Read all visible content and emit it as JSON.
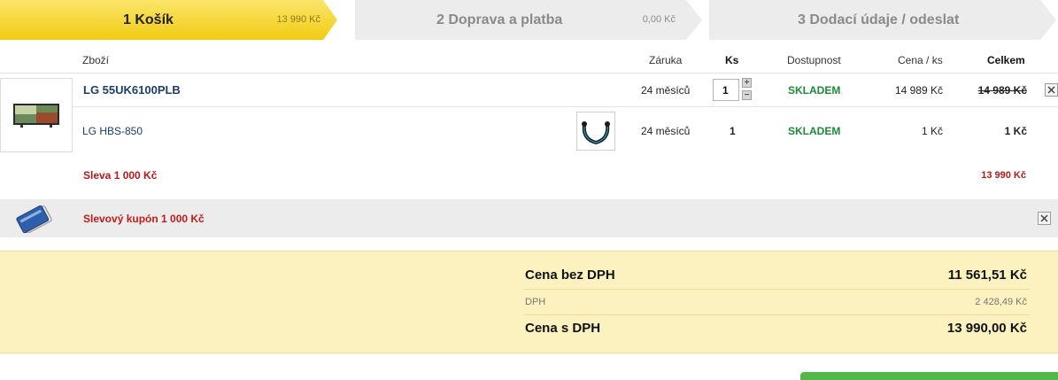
{
  "steps": [
    {
      "label": "1 Košík",
      "price": "13 990 Kč",
      "active": true
    },
    {
      "label": "2 Doprava a platba",
      "price": "0,00  Kč",
      "active": false
    },
    {
      "label": "3 Dodací údaje / odeslat",
      "price": "",
      "active": false
    }
  ],
  "colors": {
    "active_step": "#f6d21f",
    "inactive_step": "#ececec",
    "stock": "#1c8a3a",
    "discount": "#b31b1b",
    "summary_bg": "#fbf2bf",
    "cta": "#52b948"
  },
  "table": {
    "headers": {
      "product": "Zboží",
      "warranty": "Záruka",
      "qty": "Ks",
      "availability": "Dostupnost",
      "unit_price": "Cena / ks",
      "total": "Celkem"
    }
  },
  "items": [
    {
      "name": "LG 55UK6100PLB",
      "warranty": "24 měsíců",
      "qty": "1",
      "availability": "SKLADEM",
      "unit_price": "14 989 Kč",
      "total": "14 989 Kč",
      "image_icon": "tv-icon"
    },
    {
      "name": "LG HBS-850",
      "warranty": "24 měsíců",
      "qty": "1",
      "availability": "SKLADEM",
      "unit_price": "1 Kč",
      "total": "1 Kč",
      "image_icon": "headset-icon"
    }
  ],
  "discount": {
    "label": "Sleva 1 000 Kč",
    "value": "13 990 Kč"
  },
  "coupon": {
    "label": "Slevový kupón 1 000 Kč",
    "icon": "coupon-card-icon"
  },
  "summary": {
    "without_vat_label": "Cena bez DPH",
    "without_vat_value": "11 561,51 Kč",
    "vat_label": "DPH",
    "vat_value": "2 428,49 Kč",
    "with_vat_label": "Cena s DPH",
    "with_vat_value": "13 990,00 Kč"
  }
}
